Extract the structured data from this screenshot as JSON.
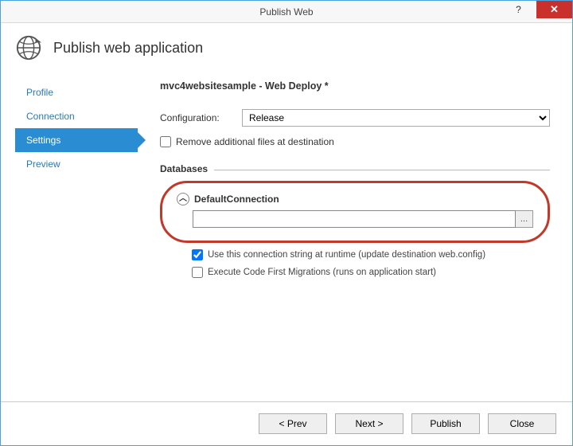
{
  "window": {
    "title": "Publish Web"
  },
  "header": {
    "title": "Publish web application"
  },
  "sidebar": {
    "items": [
      {
        "label": "Profile"
      },
      {
        "label": "Connection"
      },
      {
        "label": "Settings"
      },
      {
        "label": "Preview"
      }
    ]
  },
  "main": {
    "heading": "mvc4websitesample - Web Deploy *",
    "config_label": "Configuration:",
    "config_value": "Release",
    "remove_files_label": "Remove additional files at destination",
    "databases_label": "Databases",
    "default_connection_label": "DefaultConnection",
    "conn_value": "",
    "use_conn_label": "Use this connection string at runtime (update destination web.config)",
    "exec_migrations_label": "Execute Code First Migrations (runs on application start)"
  },
  "buttons": {
    "prev": "< Prev",
    "next": "Next >",
    "publish": "Publish",
    "close": "Close"
  },
  "symbols": {
    "help": "?",
    "close_x": "✕",
    "chevron_up": "︿",
    "ellipsis": "…"
  }
}
